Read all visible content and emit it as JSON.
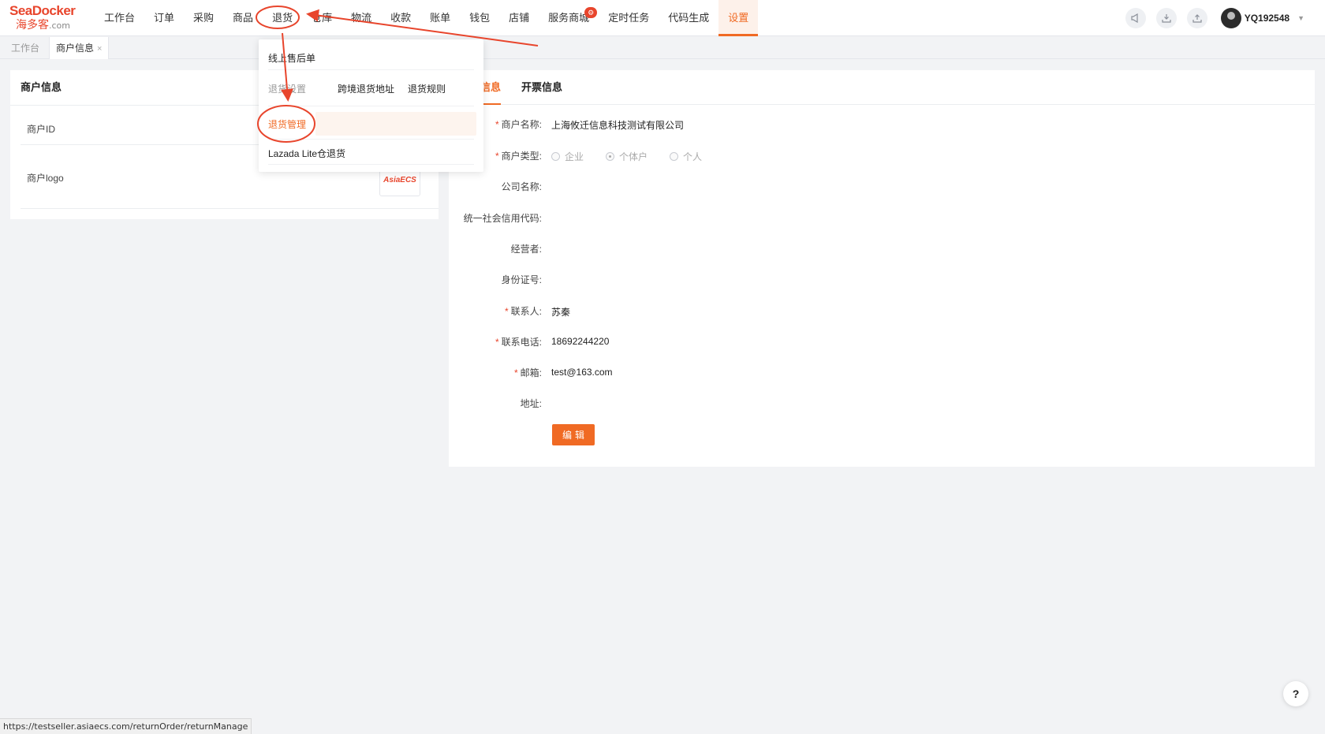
{
  "logo": {
    "brand": "SeaDocker",
    "cn": "海多客",
    "domain": ".com"
  },
  "nav": [
    {
      "label": "工作台"
    },
    {
      "label": "订单"
    },
    {
      "label": "采购"
    },
    {
      "label": "商品"
    },
    {
      "label": "退货"
    },
    {
      "label": "仓库"
    },
    {
      "label": "物流"
    },
    {
      "label": "收款"
    },
    {
      "label": "账单"
    },
    {
      "label": "钱包"
    },
    {
      "label": "店铺"
    },
    {
      "label": "服务商城",
      "badge": "⚙"
    },
    {
      "label": "定时任务"
    },
    {
      "label": "代码生成"
    },
    {
      "label": "设置"
    }
  ],
  "header_tools": {
    "icons": [
      "megaphone-icon",
      "download-icon",
      "upload-icon"
    ],
    "username": "YQ192548"
  },
  "page_tabs": [
    {
      "label": "工作台"
    },
    {
      "label": "商户信息",
      "close": "×"
    }
  ],
  "left_card": {
    "title": "商户信息",
    "rows": [
      {
        "label": "商户ID"
      },
      {
        "label": "商户logo"
      }
    ],
    "logo_text": "AsiaECS"
  },
  "right_card": {
    "tabs": [
      {
        "label": "信息"
      },
      {
        "label": "开票信息"
      }
    ],
    "fields": {
      "merchant_name": {
        "label": "商户名称:",
        "value": "上海攸迁信息科技测试有限公司",
        "required": "*"
      },
      "merchant_type": {
        "label": "商户类型:",
        "required": "*",
        "options": [
          "企业",
          "个体户",
          "个人"
        ],
        "selected": "个体户"
      },
      "company_name": {
        "label": "公司名称:"
      },
      "credit_code": {
        "label": "统一社会信用代码:"
      },
      "operator": {
        "label": "经营者:"
      },
      "id_number": {
        "label": "身份证号:"
      },
      "contact": {
        "label": "联系人:",
        "value": "苏秦",
        "required": "*"
      },
      "phone": {
        "label": "联系电话:",
        "value": "18692244220",
        "required": "*"
      },
      "email": {
        "label": "邮箱:",
        "value": "test@163.com",
        "required": "*"
      },
      "address": {
        "label": "地址:"
      }
    },
    "edit_button": "编辑"
  },
  "dropdown": {
    "item1": "线上售后单",
    "group": "退货设置",
    "sub1": "跨境退货地址",
    "sub2": "退货规则",
    "item2": "退货管理",
    "item3": "Lazada Lite仓退货"
  },
  "status_url": "https://testseller.asiaecs.com/returnOrder/returnManage",
  "help": "?",
  "colors": {
    "accent": "#f06a24",
    "brand": "#e8452c",
    "annotation": "#e8452c"
  }
}
